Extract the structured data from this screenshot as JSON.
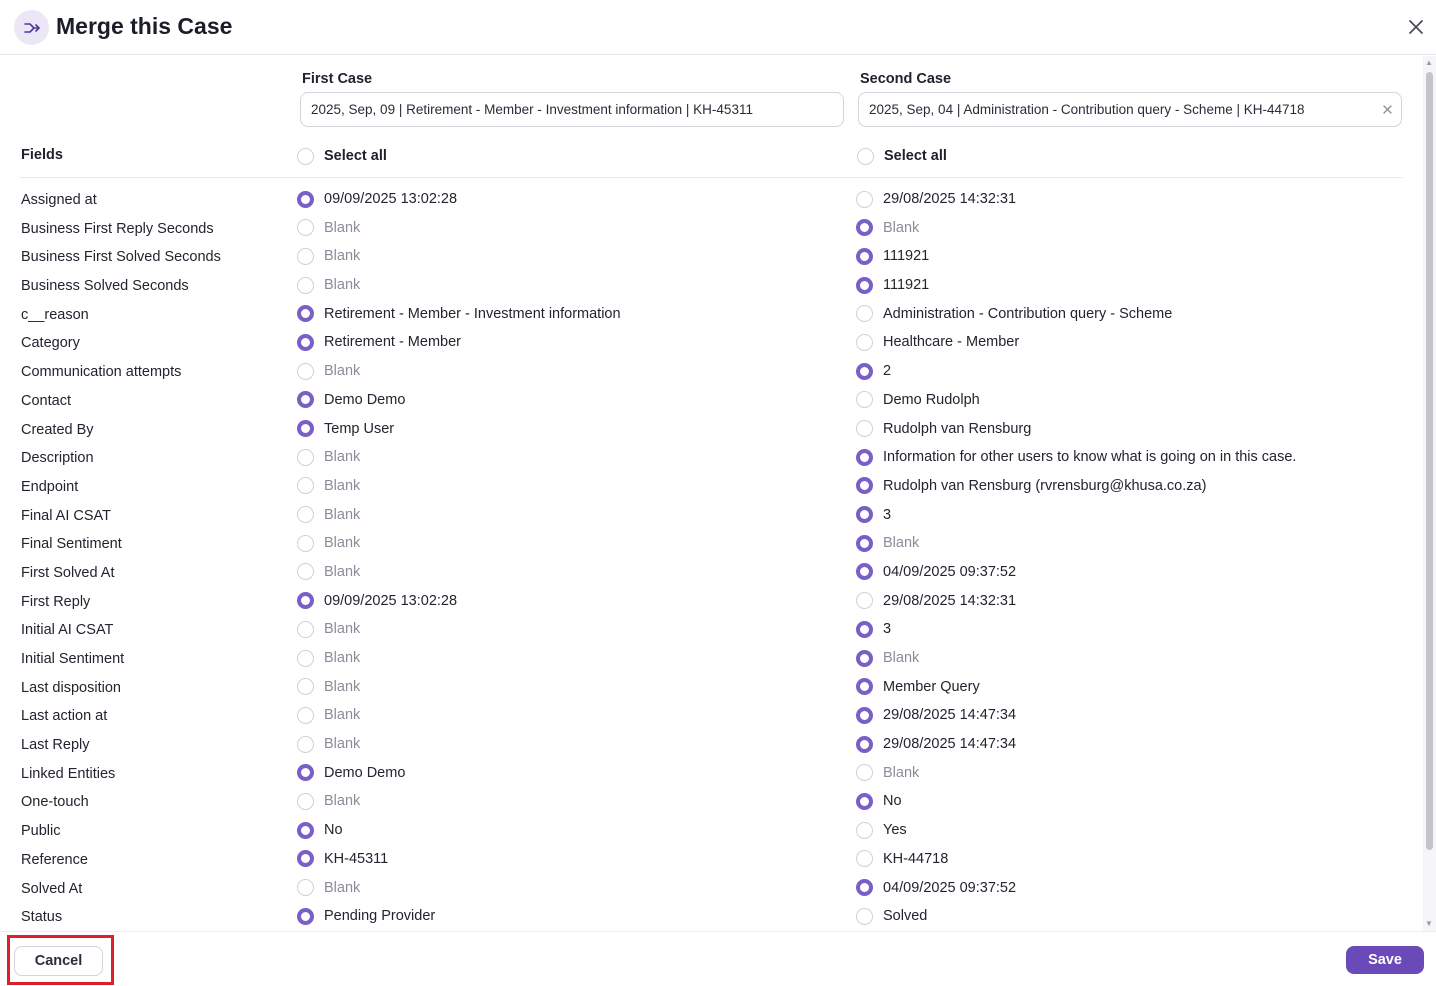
{
  "dialog": {
    "title": "Merge this Case",
    "icon": "merge-icon",
    "close_icon": "close-icon"
  },
  "cases": {
    "first": {
      "label": "First Case",
      "value": "2025, Sep, 09 | Retirement - Member - Investment information | KH-45311"
    },
    "second": {
      "label": "Second Case",
      "value": "2025, Sep, 04 | Administration - Contribution query - Scheme | KH-44718",
      "clear_icon": "clear-icon"
    }
  },
  "fields_heading": "Fields",
  "select_all": {
    "first": {
      "label": "Select all",
      "selected": false
    },
    "second": {
      "label": "Select all",
      "selected": false
    }
  },
  "rows": [
    {
      "field": "Assigned at",
      "first": "09/09/2025 13:02:28",
      "second": "29/08/2025 14:32:31",
      "selected": "first"
    },
    {
      "field": "Business First Reply Seconds",
      "first": "Blank",
      "second": "Blank",
      "selected": "second"
    },
    {
      "field": "Business First Solved Seconds",
      "first": "Blank",
      "second": "111921",
      "selected": "second"
    },
    {
      "field": "Business Solved Seconds",
      "first": "Blank",
      "second": "111921",
      "selected": "second"
    },
    {
      "field": "c__reason",
      "first": "Retirement - Member - Investment information",
      "second": "Administration - Contribution query - Scheme",
      "selected": "first"
    },
    {
      "field": "Category",
      "first": "Retirement - Member",
      "second": "Healthcare - Member",
      "selected": "first"
    },
    {
      "field": "Communication attempts",
      "first": "Blank",
      "second": "2",
      "selected": "second"
    },
    {
      "field": "Contact",
      "first": "Demo Demo",
      "second": "Demo Rudolph",
      "selected": "first"
    },
    {
      "field": "Created By",
      "first": "Temp User",
      "second": "Rudolph van Rensburg",
      "selected": "first"
    },
    {
      "field": "Description",
      "first": "Blank",
      "second": "Information for other users to know what is going on in this case.",
      "selected": "second"
    },
    {
      "field": "Endpoint",
      "first": "Blank",
      "second": "Rudolph van Rensburg (rvrensburg@khusa.co.za)",
      "selected": "second"
    },
    {
      "field": "Final AI CSAT",
      "first": "Blank",
      "second": "3",
      "selected": "second"
    },
    {
      "field": "Final Sentiment",
      "first": "Blank",
      "second": "Blank",
      "selected": "second"
    },
    {
      "field": "First Solved At",
      "first": "Blank",
      "second": "04/09/2025 09:37:52",
      "selected": "second"
    },
    {
      "field": "First Reply",
      "first": "09/09/2025 13:02:28",
      "second": "29/08/2025 14:32:31",
      "selected": "first"
    },
    {
      "field": "Initial AI CSAT",
      "first": "Blank",
      "second": "3",
      "selected": "second"
    },
    {
      "field": "Initial Sentiment",
      "first": "Blank",
      "second": "Blank",
      "selected": "second"
    },
    {
      "field": "Last disposition",
      "first": "Blank",
      "second": "Member Query",
      "selected": "second"
    },
    {
      "field": "Last action at",
      "first": "Blank",
      "second": "29/08/2025 14:47:34",
      "selected": "second"
    },
    {
      "field": "Last Reply",
      "first": "Blank",
      "second": "29/08/2025 14:47:34",
      "selected": "second"
    },
    {
      "field": "Linked Entities",
      "first": "Demo Demo",
      "second": "Blank",
      "selected": "first"
    },
    {
      "field": "One-touch",
      "first": "Blank",
      "second": "No",
      "selected": "second"
    },
    {
      "field": "Public",
      "first": "No",
      "second": "Yes",
      "selected": "first"
    },
    {
      "field": "Reference",
      "first": "KH-45311",
      "second": "KH-44718",
      "selected": "first"
    },
    {
      "field": "Solved At",
      "first": "Blank",
      "second": "04/09/2025 09:37:52",
      "selected": "second"
    },
    {
      "field": "Status",
      "first": "Pending Provider",
      "second": "Solved",
      "selected": "first"
    }
  ],
  "footer": {
    "cancel_label": "Cancel",
    "save_label": "Save"
  },
  "colors": {
    "accent": "#6a49b8",
    "radio_selected": "#7a5fc6",
    "highlight": "#e01f26",
    "blank_text": "#8a8d99"
  }
}
